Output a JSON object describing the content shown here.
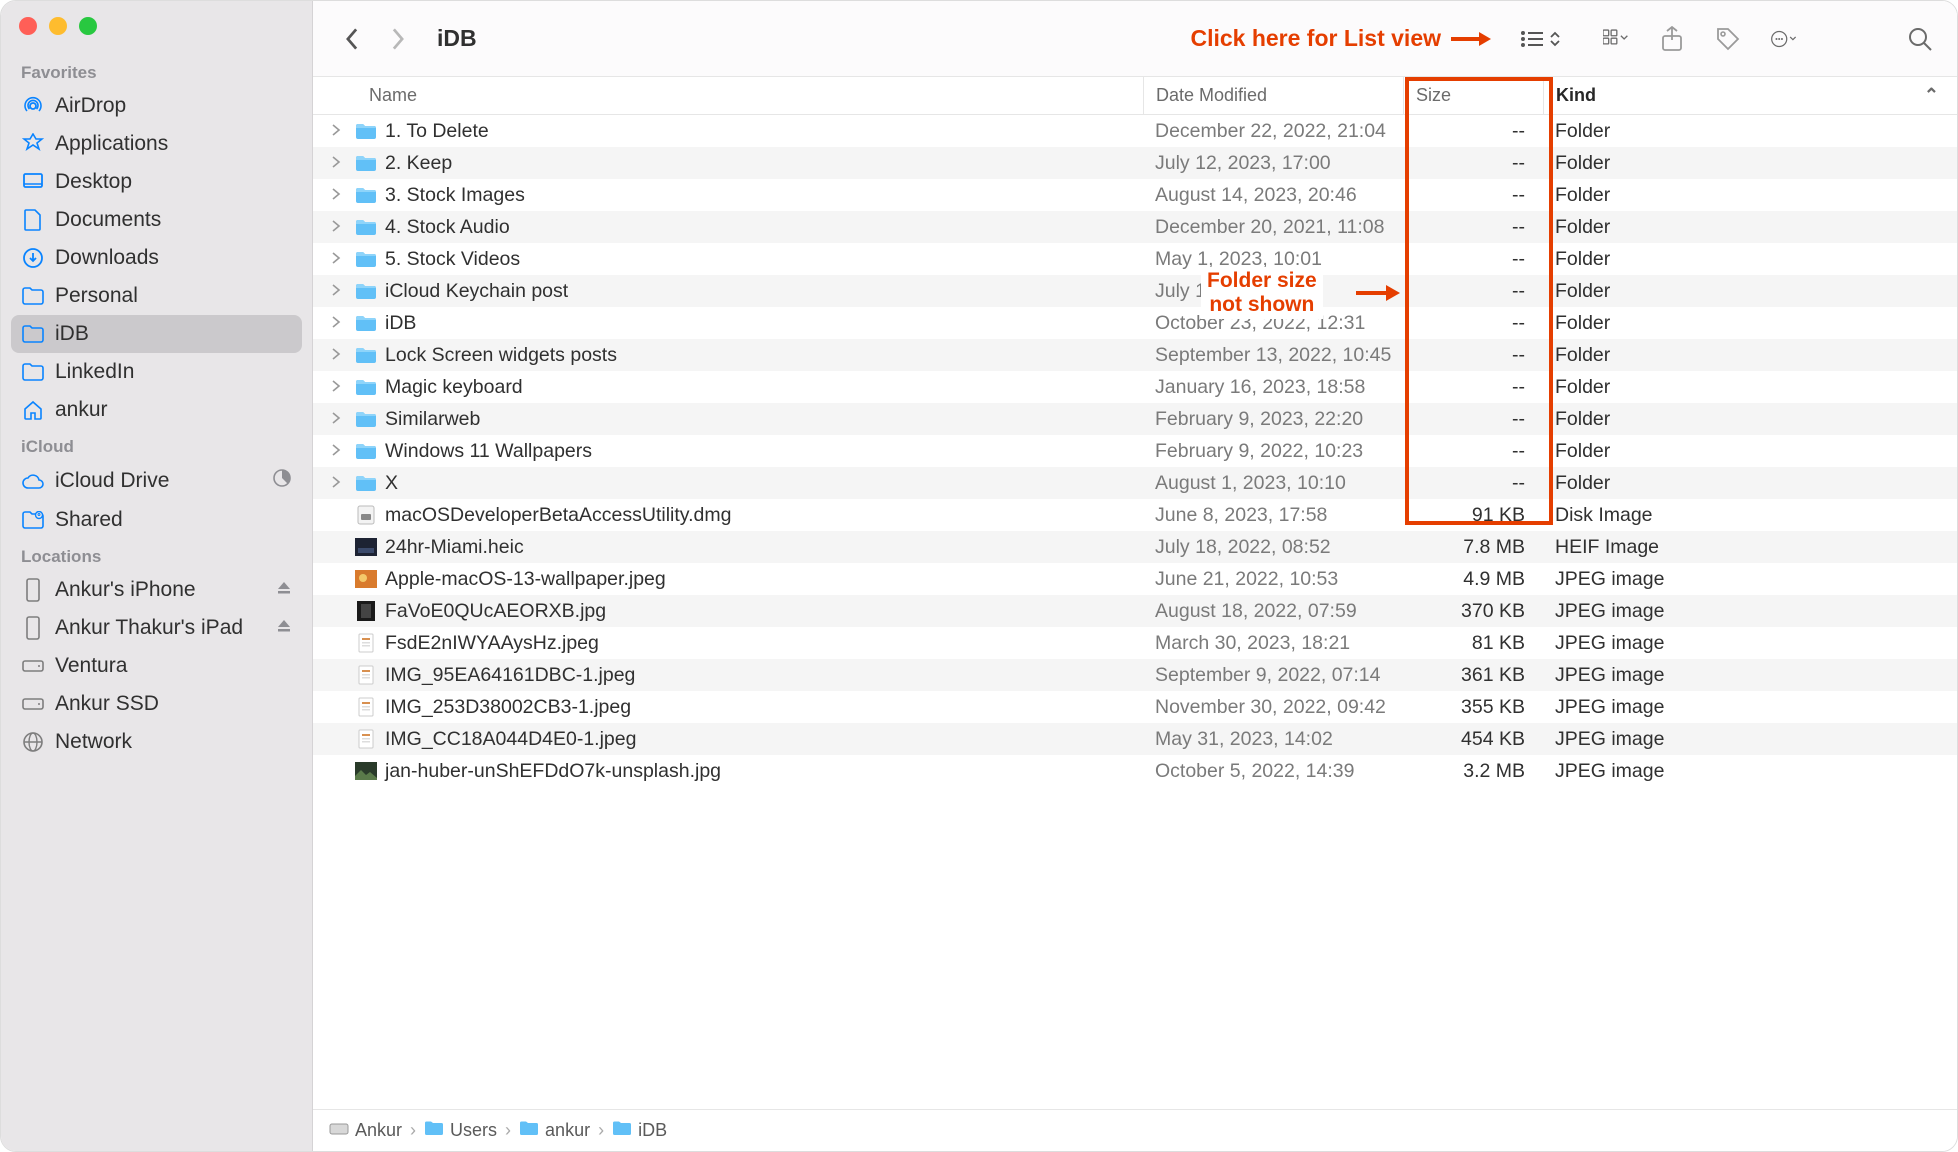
{
  "window_title": "iDB",
  "callout_listview": "Click here for List view",
  "annot_folder_size": "Folder size\nnot shown",
  "sidebar": {
    "sections": [
      {
        "title": "Favorites",
        "items": [
          {
            "label": "AirDrop",
            "icon": "airdrop"
          },
          {
            "label": "Applications",
            "icon": "apps"
          },
          {
            "label": "Desktop",
            "icon": "desktop"
          },
          {
            "label": "Documents",
            "icon": "document"
          },
          {
            "label": "Downloads",
            "icon": "download"
          },
          {
            "label": "Personal",
            "icon": "folder"
          },
          {
            "label": "iDB",
            "icon": "folder",
            "selected": true
          },
          {
            "label": "LinkedIn",
            "icon": "folder"
          },
          {
            "label": "ankur",
            "icon": "home"
          }
        ]
      },
      {
        "title": "iCloud",
        "items": [
          {
            "label": "iCloud Drive",
            "icon": "cloud",
            "pie": true
          },
          {
            "label": "Shared",
            "icon": "shared"
          }
        ]
      },
      {
        "title": "Locations",
        "items": [
          {
            "label": "Ankur's iPhone",
            "icon": "device",
            "eject": true,
            "gray": true
          },
          {
            "label": "Ankur Thakur's iPad",
            "icon": "device",
            "eject": true,
            "gray": true
          },
          {
            "label": "Ventura",
            "icon": "disk",
            "gray": true
          },
          {
            "label": "Ankur SSD",
            "icon": "disk",
            "gray": true
          },
          {
            "label": "Network",
            "icon": "network",
            "gray": true
          }
        ]
      }
    ]
  },
  "columns": {
    "name": "Name",
    "date": "Date Modified",
    "size": "Size",
    "kind": "Kind"
  },
  "files": [
    {
      "disc": true,
      "icon": "folder",
      "name": "1. To Delete",
      "date": "December 22, 2022, 21:04",
      "size": "--",
      "kind": "Folder"
    },
    {
      "disc": true,
      "icon": "folder",
      "name": "2. Keep",
      "date": "July 12, 2023, 17:00",
      "size": "--",
      "kind": "Folder"
    },
    {
      "disc": true,
      "icon": "folder",
      "name": "3. Stock Images",
      "date": "August 14, 2023, 20:46",
      "size": "--",
      "kind": "Folder"
    },
    {
      "disc": true,
      "icon": "folder",
      "name": "4. Stock Audio",
      "date": "December 20, 2021, 11:08",
      "size": "--",
      "kind": "Folder"
    },
    {
      "disc": true,
      "icon": "folder",
      "name": "5. Stock Videos",
      "date": "May 1, 2023, 10:01",
      "size": "--",
      "kind": "Folder"
    },
    {
      "disc": true,
      "icon": "folder",
      "name": "iCloud Keychain post",
      "date": "July 1",
      "size": "--",
      "kind": "Folder"
    },
    {
      "disc": true,
      "icon": "folder",
      "name": "iDB",
      "date": "October 23, 2022, 12:31",
      "size": "--",
      "kind": "Folder"
    },
    {
      "disc": true,
      "icon": "folder",
      "name": "Lock Screen widgets posts",
      "date": "September 13, 2022, 10:45",
      "size": "--",
      "kind": "Folder"
    },
    {
      "disc": true,
      "icon": "folder",
      "name": "Magic keyboard",
      "date": "January 16, 2023, 18:58",
      "size": "--",
      "kind": "Folder"
    },
    {
      "disc": true,
      "icon": "folder",
      "name": "Similarweb",
      "date": "February 9, 2023, 22:20",
      "size": "--",
      "kind": "Folder"
    },
    {
      "disc": true,
      "icon": "folder",
      "name": "Windows 11 Wallpapers",
      "date": "February 9, 2022, 10:23",
      "size": "--",
      "kind": "Folder"
    },
    {
      "disc": true,
      "icon": "folder",
      "name": "X",
      "date": "August 1, 2023, 10:10",
      "size": "--",
      "kind": "Folder"
    },
    {
      "disc": false,
      "icon": "dmg",
      "name": "macOSDeveloperBetaAccessUtility.dmg",
      "date": "June 8, 2023, 17:58",
      "size": "91 KB",
      "kind": "Disk Image"
    },
    {
      "disc": false,
      "icon": "img",
      "name": "24hr-Miami.heic",
      "date": "July 18, 2022, 08:52",
      "size": "7.8 MB",
      "kind": "HEIF Image"
    },
    {
      "disc": false,
      "icon": "img2",
      "name": "Apple-macOS-13-wallpaper.jpeg",
      "date": "June 21, 2022, 10:53",
      "size": "4.9 MB",
      "kind": "JPEG image"
    },
    {
      "disc": false,
      "icon": "img3",
      "name": "FaVoE0QUcAEORXB.jpg",
      "date": "August 18, 2022, 07:59",
      "size": "370 KB",
      "kind": "JPEG image"
    },
    {
      "disc": false,
      "icon": "doc",
      "name": "FsdE2nIWYAAysHz.jpeg",
      "date": "March 30, 2023, 18:21",
      "size": "81 KB",
      "kind": "JPEG image"
    },
    {
      "disc": false,
      "icon": "doc",
      "name": "IMG_95EA64161DBC-1.jpeg",
      "date": "September 9, 2022, 07:14",
      "size": "361 KB",
      "kind": "JPEG image"
    },
    {
      "disc": false,
      "icon": "doc",
      "name": "IMG_253D38002CB3-1.jpeg",
      "date": "November 30, 2022, 09:42",
      "size": "355 KB",
      "kind": "JPEG image"
    },
    {
      "disc": false,
      "icon": "doc",
      "name": "IMG_CC18A044D4E0-1.jpeg",
      "date": "May 31, 2023, 14:02",
      "size": "454 KB",
      "kind": "JPEG image"
    },
    {
      "disc": false,
      "icon": "img4",
      "name": "jan-huber-unShEFDdO7k-unsplash.jpg",
      "date": "October 5, 2022, 14:39",
      "size": "3.2 MB",
      "kind": "JPEG image"
    }
  ],
  "pathbar": [
    {
      "icon": "disk",
      "label": "Ankur"
    },
    {
      "icon": "folder",
      "label": "Users"
    },
    {
      "icon": "folder",
      "label": "ankur"
    },
    {
      "icon": "folder",
      "label": "iDB"
    }
  ]
}
